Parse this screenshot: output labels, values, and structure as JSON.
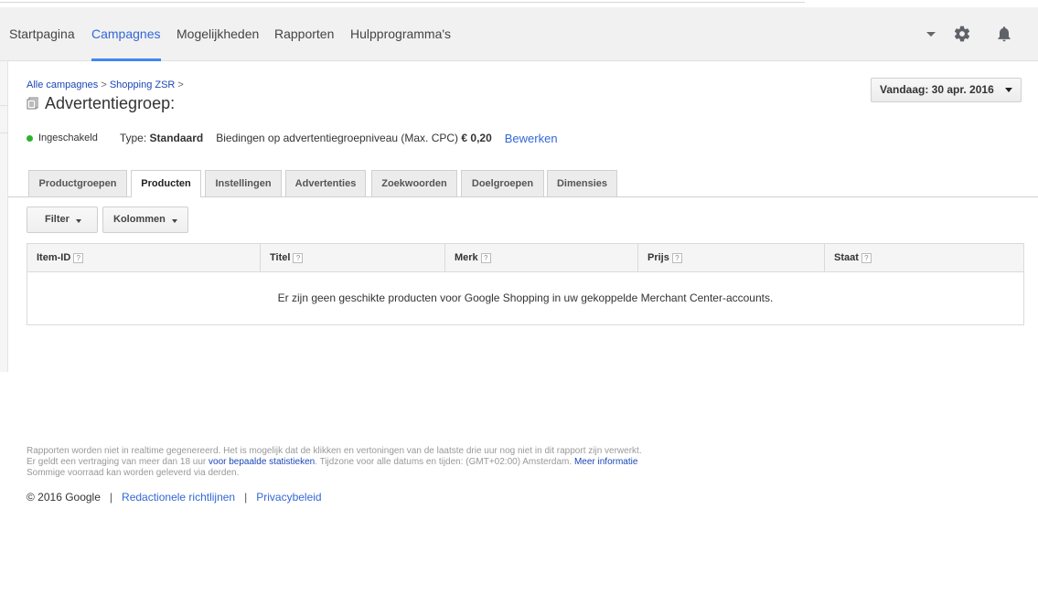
{
  "nav": {
    "items": [
      {
        "label": "Startpagina"
      },
      {
        "label": "Campagnes"
      },
      {
        "label": "Mogelijkheden"
      },
      {
        "label": "Rapporten"
      },
      {
        "label": "Hulpprogramma's"
      }
    ],
    "active_index": 1
  },
  "breadcrumb": {
    "link1": "Alle campagnes",
    "sep1": " > ",
    "link2": "Shopping ZSR",
    "sep2": " >"
  },
  "page_title": "Advertentiegroep:",
  "date_range": "Vandaag: 30 apr. 2016",
  "status": {
    "state": "Ingeschakeld",
    "type_label": "Type:",
    "type_value": "Standaard",
    "bid_label": "Biedingen op advertentiegroepniveau (Max. CPC)",
    "bid_value": "€ 0,20",
    "edit_label": "Bewerken",
    "state_color": "#2bb32b"
  },
  "tabs": [
    {
      "label": "Productgroepen"
    },
    {
      "label": "Producten"
    },
    {
      "label": "Instellingen"
    },
    {
      "label": "Advertenties"
    },
    {
      "label": "Zoekwoorden"
    },
    {
      "label": "Doelgroepen"
    },
    {
      "label": "Dimensies"
    }
  ],
  "active_tab": 1,
  "toolbar": {
    "filter_label": "Filter",
    "columns_label": "Kolommen"
  },
  "table": {
    "columns": [
      "Item-ID",
      "Titel",
      "Merk",
      "Prijs",
      "Staat"
    ],
    "help_glyph": "?",
    "empty_message": "Er zijn geen geschikte producten voor Google Shopping in uw gekoppelde Merchant Center-accounts."
  },
  "footnotes": {
    "line1": "Rapporten worden niet in realtime gegenereerd. Het is mogelijk dat de klikken en vertoningen van de laatste drie uur nog niet in dit rapport zijn verwerkt.",
    "line2_pre": "Er geldt een vertraging van meer dan 18 uur ",
    "line2_link": "voor bepaalde statistieken",
    "line2_mid": ". Tijdzone voor alle datums en tijden: (GMT+02:00) Amsterdam. ",
    "line2_link2": "Meer informatie",
    "line3": "Sommige voorraad kan worden geleverd via derden."
  },
  "footer": {
    "copyright": "© 2016 Google",
    "sep": "|",
    "link1": "Redactionele richtlijnen",
    "link2": "Privacybeleid"
  },
  "colors": {
    "accent": "#4285f4",
    "link": "#3367d6"
  }
}
